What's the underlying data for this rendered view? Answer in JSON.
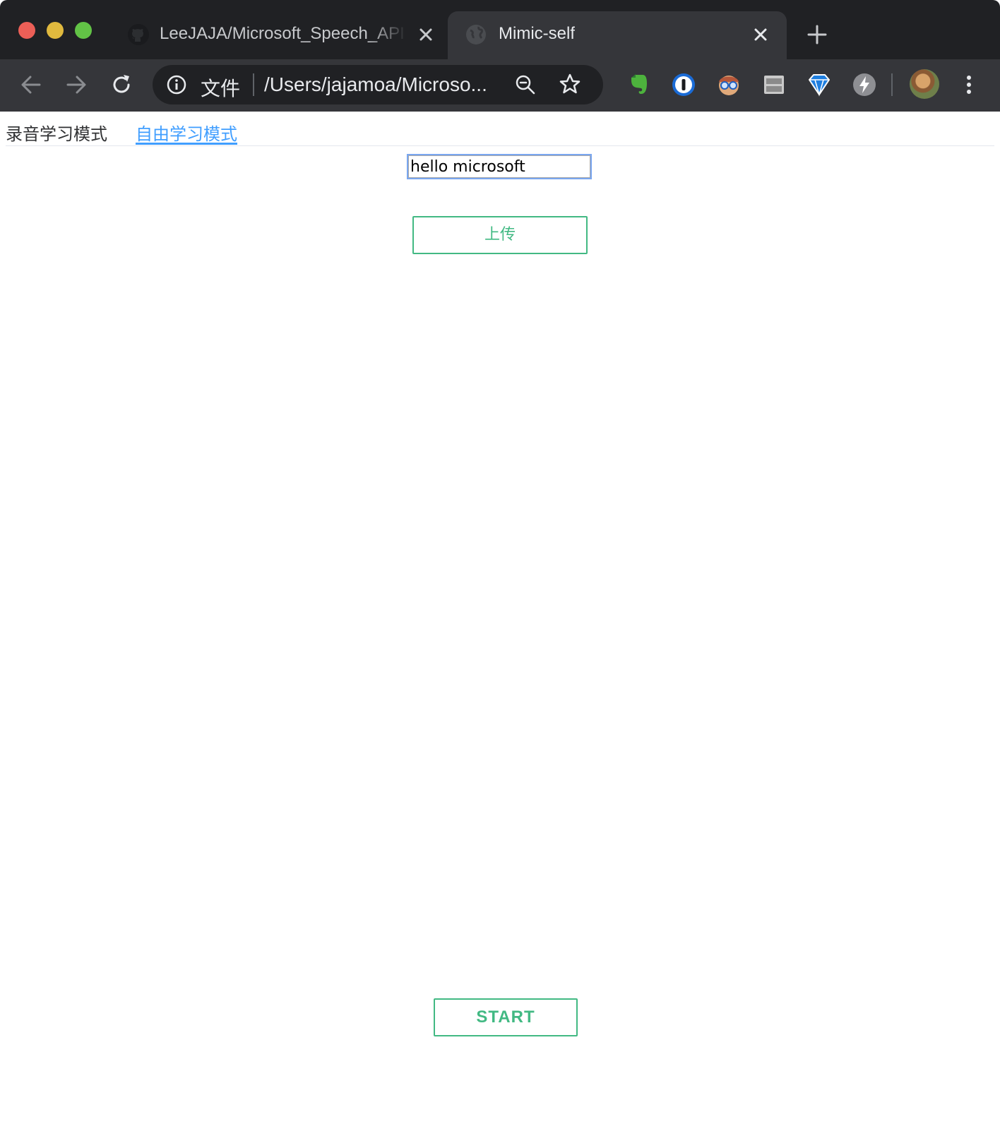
{
  "browser": {
    "tabs": [
      {
        "title": "LeeJAJA/Microsoft_Speech_API",
        "favicon": "github-icon",
        "active": false
      },
      {
        "title": "Mimic-self",
        "favicon": "globe-icon",
        "active": true
      }
    ],
    "address_bar": {
      "scheme_label": "文件",
      "url": "/Users/jajamoa/Microso..."
    },
    "extensions": [
      "evernote-icon",
      "1password-icon",
      "reader-glasses-icon",
      "stack-icon",
      "diamond-icon",
      "bolt-icon"
    ],
    "accent": "#202124"
  },
  "page": {
    "tabs": [
      {
        "label": "录音学习模式",
        "active": false
      },
      {
        "label": "自由学习模式",
        "active": true
      }
    ],
    "text_input_value": "hello microsoft",
    "upload_button": "上传",
    "start_button": "START",
    "colors": {
      "accent_green": "#42b983",
      "tab_active_blue": "#409eff"
    }
  }
}
